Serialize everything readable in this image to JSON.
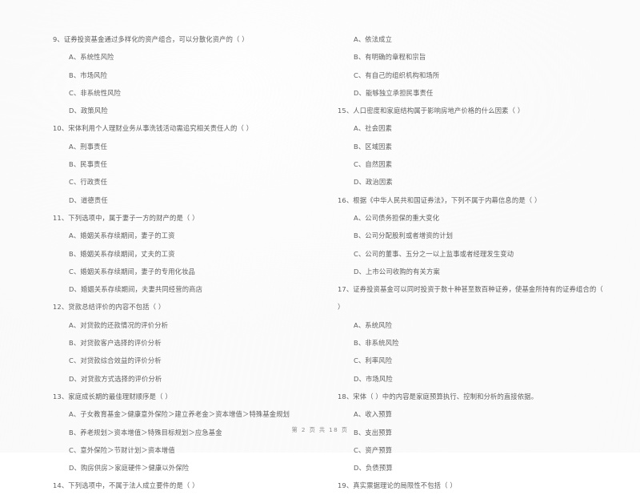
{
  "document": {
    "type": "exam-paper-scan",
    "page_footer": "第 2 页 共 18 页",
    "background_color": "#fefefe",
    "text_color": "#5e5e5e"
  },
  "left_column": {
    "questions": [
      {
        "number": "9",
        "stem": "9、证券投资基金通过多样化的资产组合，可以分散化资产的（      ）",
        "options": [
          "A、系统性风险",
          "B、市场风险",
          "C、非系统性风险",
          "D、政策风险"
        ]
      },
      {
        "number": "10",
        "stem": "10、宋体利用个人理财业务从事洗钱活动需追究相关责任人的（      ）",
        "options": [
          "A、刑事责任",
          "B、民事责任",
          "C、行政责任",
          "D、道德责任"
        ]
      },
      {
        "number": "11",
        "stem": "11、下列选项中，属于妻子一方的财产的是（      ）",
        "options": [
          "A、婚姻关系存续期间，妻子的工资",
          "B、婚姻关系存续期间，丈夫的工资",
          "C、婚姻关系存续期间，妻子的专用化妆品",
          "D、婚姻关系存续期间，夫妻共同经营的商店"
        ]
      },
      {
        "number": "12",
        "stem": "12、贷款总结评价的内容不包括（      ）",
        "options": [
          "A、对贷款的还款情况的评价分析",
          "B、对贷款客户选择的评价分析",
          "C、对贷款综合效益的评价分析",
          "D、对贷款方式选择的评价分析"
        ]
      },
      {
        "number": "13",
        "stem": "13、家庭成长期的最佳理财顺序是（      ）",
        "options": [
          "A、子女教育基金＞健康意外保险＞建立养老金＞资本增值＞特殊基金规划",
          "B、养老规划＞资本增值＞特殊目标规划＞应急基金",
          "C、意外保险＞节财计划＞资本增值",
          "D、购房供房＞家庭硬件＞健康以外保险"
        ]
      },
      {
        "number": "14",
        "stem": "14、下列选项中，不属于法人成立要件的是（      ）",
        "options": []
      }
    ]
  },
  "right_column": {
    "continued_options": [
      "A、依法成立",
      "B、有明确的章程和宗旨",
      "C、有自己的组织机构和场所",
      "D、能够独立承担民事责任"
    ],
    "questions": [
      {
        "number": "15",
        "stem": "15、人口密度和家庭结构属于影响房地产价格的什么因素（      ）",
        "options": [
          "A、社会因素",
          "B、区域因素",
          "C、自然因素",
          "D、政治因素"
        ]
      },
      {
        "number": "16",
        "stem": "16、根据《中华人民共和国证券法》，下列不属于内幕信息的是（      ）",
        "options": [
          "A、公司债务担保的重大变化",
          "B、公司分配股利或者增资的计划",
          "C、公司的董事、五分之一以上监事或者经理发生变动",
          "D、上市公司收购的有关方案"
        ]
      },
      {
        "number": "17",
        "stem": "17、证券投资基金可以同时投资于数十种甚至数百种证券，使基金所持有的证券组合的（",
        "stem_cont": "）",
        "options": [
          "A、系统风险",
          "B、非系统风险",
          "C、利率风险",
          "D、市场风险"
        ]
      },
      {
        "number": "18",
        "stem": "18、宋体（      ）中的内容是家庭预算执行、控制和分析的直接依据。",
        "options": [
          "A、收入预算",
          "B、支出预算",
          "C、资产预算",
          "D、负债预算"
        ]
      },
      {
        "number": "19",
        "stem": "19、真实票据理论的局限性不包括（      ）",
        "options": []
      }
    ]
  }
}
